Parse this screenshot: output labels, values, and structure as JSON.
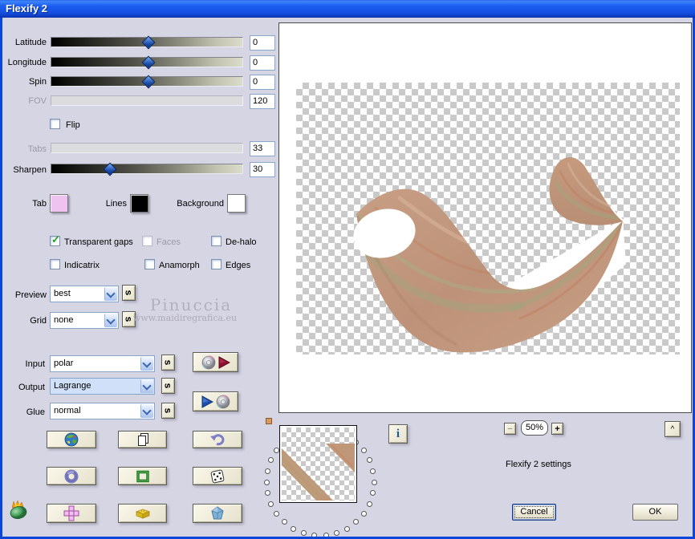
{
  "window": {
    "title": "Flexify 2"
  },
  "colors": {
    "titlebar_blue": "#1a5ae8",
    "panel_bg": "#d5d5e3",
    "window_edge": "#0c46d8",
    "check_green": "#1fa11f"
  },
  "sliders": [
    {
      "label": "Latitude",
      "value": "0",
      "disabled": false,
      "thumb_pct": 50
    },
    {
      "label": "Longitude",
      "value": "0",
      "disabled": false,
      "thumb_pct": 50
    },
    {
      "label": "Spin",
      "value": "0",
      "disabled": false,
      "thumb_pct": 50
    },
    {
      "label": "FOV",
      "value": "120",
      "disabled": true,
      "thumb_pct": null
    },
    {
      "label": "Tabs",
      "value": "33",
      "disabled": true,
      "thumb_pct": null
    },
    {
      "label": "Sharpen",
      "value": "30",
      "disabled": false,
      "thumb_pct": 30
    }
  ],
  "flip": {
    "label": "Flip",
    "checked": false
  },
  "swatches": [
    {
      "label": "Tab",
      "color": "#efc3ef"
    },
    {
      "label": "Lines",
      "color": "#000000"
    },
    {
      "label": "Background",
      "color": "#ffffff"
    }
  ],
  "checkboxes": [
    {
      "label": "Transparent gaps",
      "checked": true,
      "disabled": false
    },
    {
      "label": "Faces",
      "checked": false,
      "disabled": true
    },
    {
      "label": "De-halo",
      "checked": false,
      "disabled": false
    },
    {
      "label": "Indicatrix",
      "checked": false,
      "disabled": false
    },
    {
      "label": "Anamorph",
      "checked": false,
      "disabled": false
    },
    {
      "label": "Edges",
      "checked": false,
      "disabled": false
    }
  ],
  "combos": [
    {
      "label": "Preview",
      "value": "best"
    },
    {
      "label": "Grid",
      "value": "none"
    },
    {
      "label": "Input",
      "value": "polar"
    },
    {
      "label": "Output",
      "value": "Lagrange"
    },
    {
      "label": "Glue",
      "value": "normal"
    }
  ],
  "shuffle_button": "s",
  "watermark": {
    "line1": "Pinuccia",
    "line2": "www.maidiregrafica.eu"
  },
  "zoom_controls": {
    "minus": "−",
    "level": "50%",
    "plus": "+",
    "collapse": "^"
  },
  "info_button": "i",
  "status_text": "Flexify 2 settings",
  "actions": {
    "cancel": "Cancel",
    "ok": "OK"
  }
}
